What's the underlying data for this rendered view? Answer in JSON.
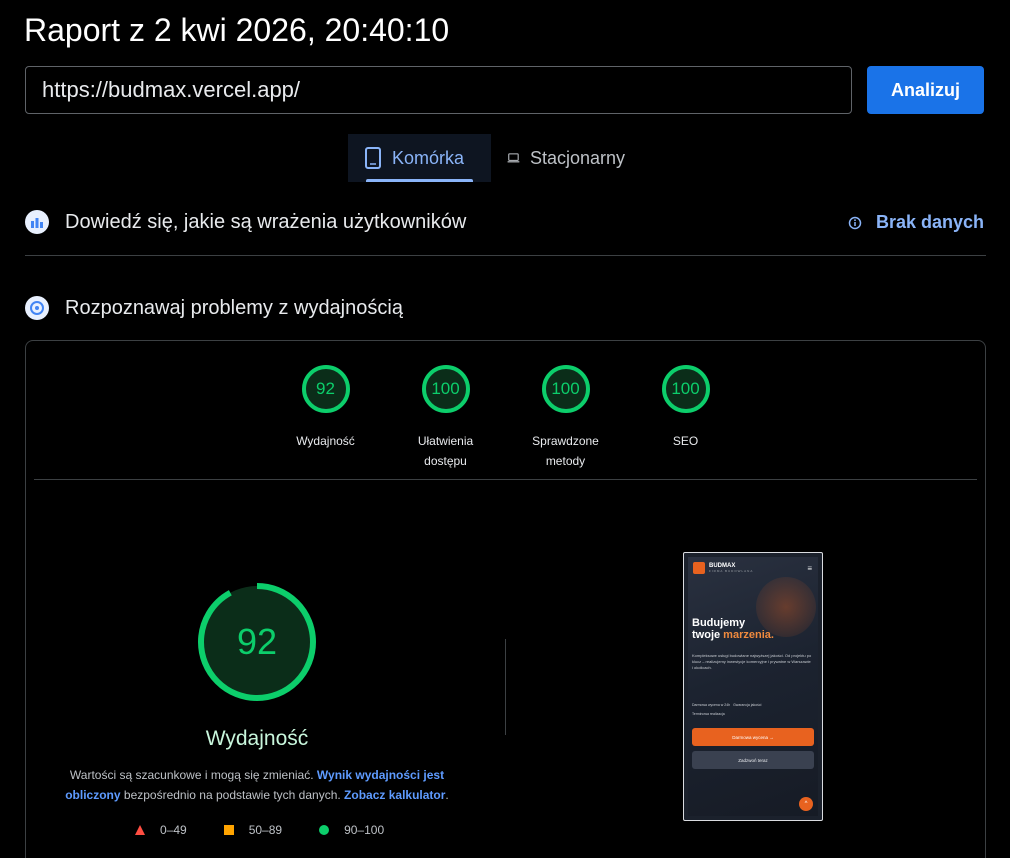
{
  "header": {
    "title": "Raport z 2 kwi 2026, 20:40:10"
  },
  "search": {
    "url": "https://budmax.vercel.app/",
    "analyze_label": "Analizuj"
  },
  "tabs": [
    {
      "label": "Komórka",
      "icon": "phone-icon",
      "active": true
    },
    {
      "label": "Stacjonarny",
      "icon": "laptop-icon",
      "active": false
    }
  ],
  "field_section": {
    "title": "Dowiedź się, jakie są wrażenia użytkowników",
    "no_data_label": "Brak danych"
  },
  "lab_section": {
    "title": "Rozpoznawaj problemy z wydajnością"
  },
  "scores": [
    {
      "value": "92",
      "label": "Wydajność"
    },
    {
      "value": "100",
      "label": "Ułatwienia dostępu"
    },
    {
      "value": "100",
      "label": "Sprawdzone metody"
    },
    {
      "value": "100",
      "label": "SEO"
    }
  ],
  "performance": {
    "score": "92",
    "score_fraction": 0.92,
    "label": "Wydajność",
    "note_prefix": "Wartości są szacunkowe i mogą się zmieniać. ",
    "note_link1": "Wynik wydajności jest obliczony",
    "note_middle": " bezpośrednio na podstawie tych danych. ",
    "note_link2": "Zobacz kalkulator",
    "note_suffix": "."
  },
  "legend": [
    {
      "range": "0–49",
      "shape": "triangle",
      "color": "#ff4e42"
    },
    {
      "range": "50–89",
      "shape": "square",
      "color": "#ffa400"
    },
    {
      "range": "90–100",
      "shape": "circle",
      "color": "#0cce6b"
    }
  ],
  "colors": {
    "good": "#0cce6b",
    "accent": "#1a73e8",
    "link": "#8ab4f8"
  },
  "preview": {
    "brand": "BUDMAX",
    "brand_sub": "FIRMA BUDOWLANA",
    "headline_line1": "Budujemy",
    "headline_line2_a": "twoje ",
    "headline_line2_b": "marzenia.",
    "body": "Kompleksowe usługi budowlane najwyższej jakości. Od projektu po klucz – realizujemy inwestycje komercyjne i prywatne w Warszawie i okolicach.",
    "bullet1": "Darmowa wycena w 24h",
    "bullet2": "Gwarancja jakości",
    "bullet3": "Terminowa realizacja",
    "cta1": "Darmowa wycena →",
    "cta2": "Zadzwoń teraz"
  }
}
